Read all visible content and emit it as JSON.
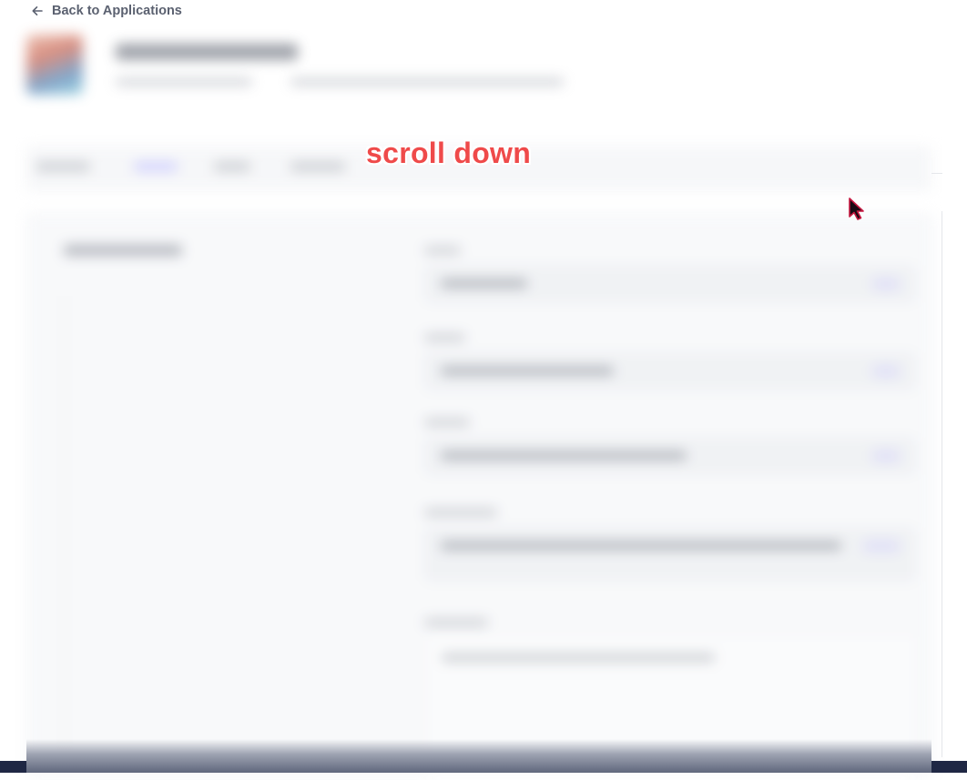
{
  "nav": {
    "back_label": "Back to Applications",
    "back_icon": "arrow-left-icon"
  },
  "overlay": {
    "instruction": "scroll down",
    "instruction_color": "#ef4a4a",
    "cursor_icon": "mouse-pointer-icon"
  },
  "colors": {
    "nav_text": "#5b6170",
    "accent": "#5a5cf5",
    "footer_bar": "#1f2744"
  }
}
